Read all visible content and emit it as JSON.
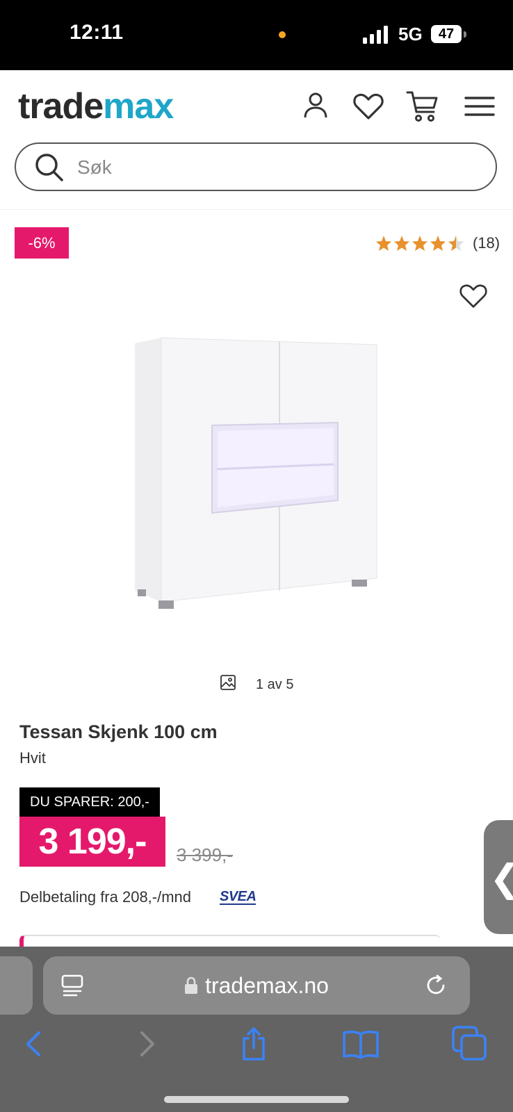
{
  "status_bar": {
    "time": "12:11",
    "network": "5G",
    "battery": "47"
  },
  "header": {
    "logo_part1": "trade",
    "logo_part2": "max",
    "search_placeholder": "Søk"
  },
  "product": {
    "discount_badge": "-6%",
    "rating_stars": 4.5,
    "review_count": "(18)",
    "image_counter": "1 av 5",
    "title": "Tessan Skjenk 100 cm",
    "variant": "Hvit",
    "savings": "DU SPARER: 200,-",
    "price": "3 199,-",
    "old_price": "3 399,-",
    "installment": "Delbetaling fra 208,-/mnd",
    "payment_provider": "SVEA"
  },
  "browser": {
    "url": "trademax.no"
  },
  "colors": {
    "brand_pink": "#e5196b",
    "logo_blue": "#1fa6c8",
    "star_orange": "#e8912d"
  }
}
